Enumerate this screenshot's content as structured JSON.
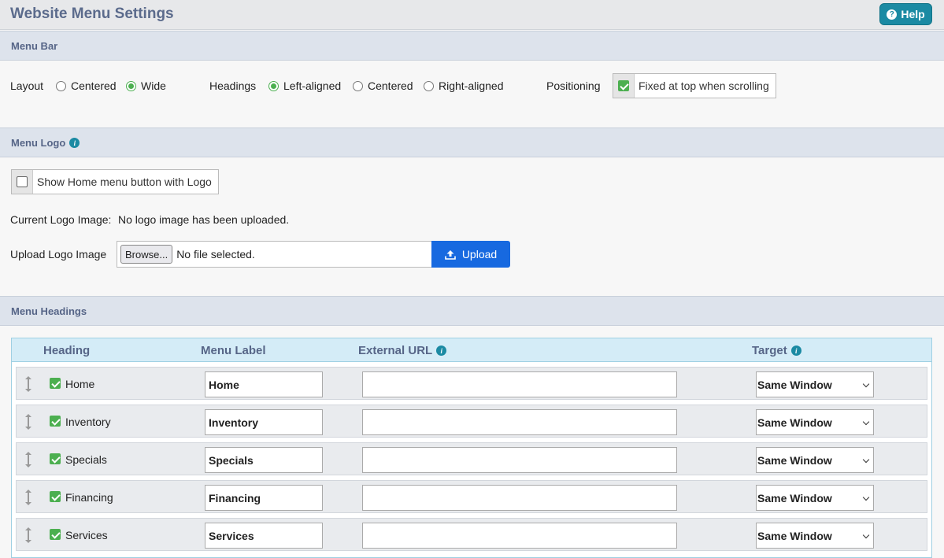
{
  "page": {
    "title": "Website Menu Settings",
    "help_label": "Help"
  },
  "menu_bar": {
    "section_title": "Menu Bar",
    "layout_label": "Layout",
    "layout_options": [
      "Centered",
      "Wide"
    ],
    "layout_selected": "Wide",
    "headings_label": "Headings",
    "headings_options": [
      "Left-aligned",
      "Centered",
      "Right-aligned"
    ],
    "headings_selected": "Left-aligned",
    "positioning_label": "Positioning",
    "positioning_checkbox_label": "Fixed at top when scrolling",
    "positioning_checked": true
  },
  "menu_logo": {
    "section_title": "Menu Logo",
    "show_home_label": "Show Home menu button with Logo",
    "show_home_checked": false,
    "current_logo_label": "Current Logo Image:",
    "current_logo_value": "No logo image has been uploaded.",
    "upload_label": "Upload Logo Image",
    "browse_label": "Browse...",
    "file_status": "No file selected.",
    "upload_button": "Upload"
  },
  "menu_headings": {
    "section_title": "Menu Headings",
    "columns": [
      "Heading",
      "Menu Label",
      "External URL",
      "Target"
    ],
    "rows": [
      {
        "heading": "Home",
        "checked": true,
        "menu_label": "Home",
        "external_url": "",
        "target": "Same Window"
      },
      {
        "heading": "Inventory",
        "checked": true,
        "menu_label": "Inventory",
        "external_url": "",
        "target": "Same Window"
      },
      {
        "heading": "Specials",
        "checked": true,
        "menu_label": "Specials",
        "external_url": "",
        "target": "Same Window"
      },
      {
        "heading": "Financing",
        "checked": true,
        "menu_label": "Financing",
        "external_url": "",
        "target": "Same Window"
      },
      {
        "heading": "Services",
        "checked": true,
        "menu_label": "Services",
        "external_url": "",
        "target": "Same Window"
      }
    ]
  },
  "colors": {
    "accent": "#1b8aa3",
    "upload": "#1769e0",
    "check": "#4caf50",
    "section_text": "#566587"
  }
}
